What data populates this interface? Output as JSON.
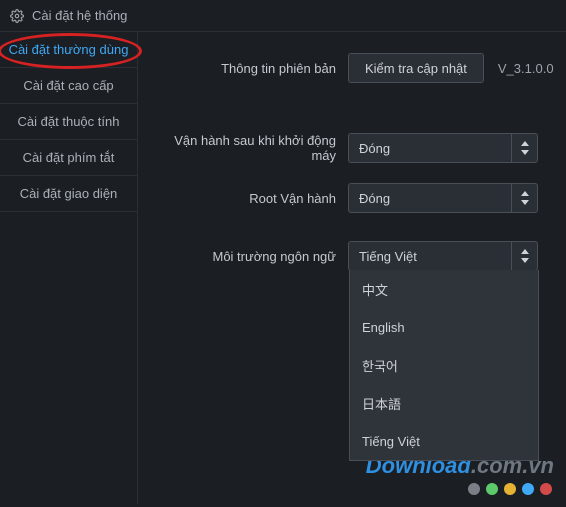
{
  "header": {
    "title": "Cài đặt hệ thống"
  },
  "sidebar": {
    "items": [
      {
        "label": "Cài đặt thường dùng"
      },
      {
        "label": "Cài đặt cao cấp"
      },
      {
        "label": "Cài đặt thuộc tính"
      },
      {
        "label": "Cài đặt phím tắt"
      },
      {
        "label": "Cài đặt giao diện"
      }
    ]
  },
  "content": {
    "version_label": "Thông tin phiên bản",
    "update_button": "Kiểm tra cập nhật",
    "version_text": "V_3.1.0.0",
    "autostart_label": "Vận hành sau khi khởi động máy",
    "autostart_value": "Đóng",
    "root_label": "Root Vận hành",
    "root_value": "Đóng",
    "language_label": "Môi trường ngôn ngữ",
    "language_value": "Tiếng Việt",
    "language_options": [
      {
        "label": "中文"
      },
      {
        "label": "English"
      },
      {
        "label": "한국어"
      },
      {
        "label": "日本語"
      },
      {
        "label": "Tiếng Việt"
      }
    ]
  },
  "watermark": {
    "left": "Download",
    "right": ".com.vn"
  },
  "dots": [
    "#7b8088",
    "#5cc96a",
    "#e5b234",
    "#3fa9f5",
    "#d24a4a"
  ]
}
